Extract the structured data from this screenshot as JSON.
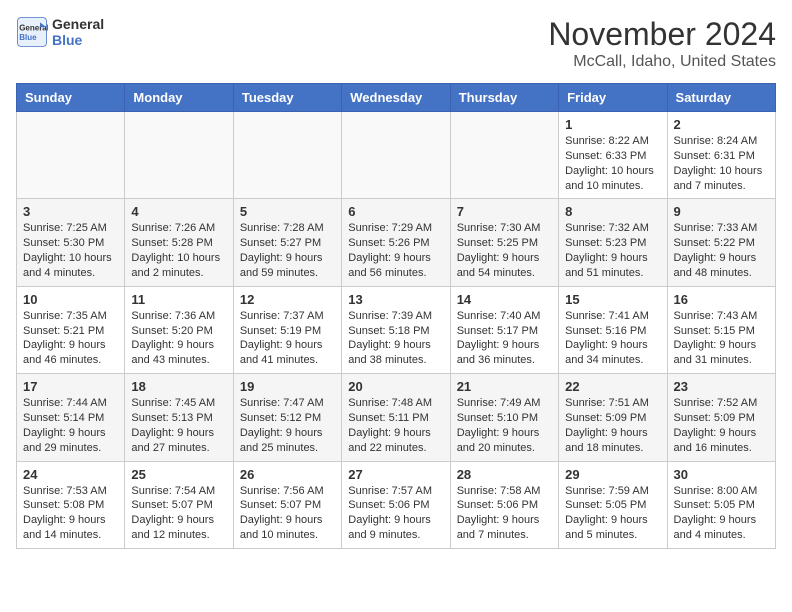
{
  "header": {
    "logo_line1": "General",
    "logo_line2": "Blue",
    "month": "November 2024",
    "location": "McCall, Idaho, United States"
  },
  "days_of_week": [
    "Sunday",
    "Monday",
    "Tuesday",
    "Wednesday",
    "Thursday",
    "Friday",
    "Saturday"
  ],
  "weeks": [
    [
      {
        "day": "",
        "data": ""
      },
      {
        "day": "",
        "data": ""
      },
      {
        "day": "",
        "data": ""
      },
      {
        "day": "",
        "data": ""
      },
      {
        "day": "",
        "data": ""
      },
      {
        "day": "1",
        "data": "Sunrise: 8:22 AM\nSunset: 6:33 PM\nDaylight: 10 hours and 10 minutes."
      },
      {
        "day": "2",
        "data": "Sunrise: 8:24 AM\nSunset: 6:31 PM\nDaylight: 10 hours and 7 minutes."
      }
    ],
    [
      {
        "day": "3",
        "data": "Sunrise: 7:25 AM\nSunset: 5:30 PM\nDaylight: 10 hours and 4 minutes."
      },
      {
        "day": "4",
        "data": "Sunrise: 7:26 AM\nSunset: 5:28 PM\nDaylight: 10 hours and 2 minutes."
      },
      {
        "day": "5",
        "data": "Sunrise: 7:28 AM\nSunset: 5:27 PM\nDaylight: 9 hours and 59 minutes."
      },
      {
        "day": "6",
        "data": "Sunrise: 7:29 AM\nSunset: 5:26 PM\nDaylight: 9 hours and 56 minutes."
      },
      {
        "day": "7",
        "data": "Sunrise: 7:30 AM\nSunset: 5:25 PM\nDaylight: 9 hours and 54 minutes."
      },
      {
        "day": "8",
        "data": "Sunrise: 7:32 AM\nSunset: 5:23 PM\nDaylight: 9 hours and 51 minutes."
      },
      {
        "day": "9",
        "data": "Sunrise: 7:33 AM\nSunset: 5:22 PM\nDaylight: 9 hours and 48 minutes."
      }
    ],
    [
      {
        "day": "10",
        "data": "Sunrise: 7:35 AM\nSunset: 5:21 PM\nDaylight: 9 hours and 46 minutes."
      },
      {
        "day": "11",
        "data": "Sunrise: 7:36 AM\nSunset: 5:20 PM\nDaylight: 9 hours and 43 minutes."
      },
      {
        "day": "12",
        "data": "Sunrise: 7:37 AM\nSunset: 5:19 PM\nDaylight: 9 hours and 41 minutes."
      },
      {
        "day": "13",
        "data": "Sunrise: 7:39 AM\nSunset: 5:18 PM\nDaylight: 9 hours and 38 minutes."
      },
      {
        "day": "14",
        "data": "Sunrise: 7:40 AM\nSunset: 5:17 PM\nDaylight: 9 hours and 36 minutes."
      },
      {
        "day": "15",
        "data": "Sunrise: 7:41 AM\nSunset: 5:16 PM\nDaylight: 9 hours and 34 minutes."
      },
      {
        "day": "16",
        "data": "Sunrise: 7:43 AM\nSunset: 5:15 PM\nDaylight: 9 hours and 31 minutes."
      }
    ],
    [
      {
        "day": "17",
        "data": "Sunrise: 7:44 AM\nSunset: 5:14 PM\nDaylight: 9 hours and 29 minutes."
      },
      {
        "day": "18",
        "data": "Sunrise: 7:45 AM\nSunset: 5:13 PM\nDaylight: 9 hours and 27 minutes."
      },
      {
        "day": "19",
        "data": "Sunrise: 7:47 AM\nSunset: 5:12 PM\nDaylight: 9 hours and 25 minutes."
      },
      {
        "day": "20",
        "data": "Sunrise: 7:48 AM\nSunset: 5:11 PM\nDaylight: 9 hours and 22 minutes."
      },
      {
        "day": "21",
        "data": "Sunrise: 7:49 AM\nSunset: 5:10 PM\nDaylight: 9 hours and 20 minutes."
      },
      {
        "day": "22",
        "data": "Sunrise: 7:51 AM\nSunset: 5:09 PM\nDaylight: 9 hours and 18 minutes."
      },
      {
        "day": "23",
        "data": "Sunrise: 7:52 AM\nSunset: 5:09 PM\nDaylight: 9 hours and 16 minutes."
      }
    ],
    [
      {
        "day": "24",
        "data": "Sunrise: 7:53 AM\nSunset: 5:08 PM\nDaylight: 9 hours and 14 minutes."
      },
      {
        "day": "25",
        "data": "Sunrise: 7:54 AM\nSunset: 5:07 PM\nDaylight: 9 hours and 12 minutes."
      },
      {
        "day": "26",
        "data": "Sunrise: 7:56 AM\nSunset: 5:07 PM\nDaylight: 9 hours and 10 minutes."
      },
      {
        "day": "27",
        "data": "Sunrise: 7:57 AM\nSunset: 5:06 PM\nDaylight: 9 hours and 9 minutes."
      },
      {
        "day": "28",
        "data": "Sunrise: 7:58 AM\nSunset: 5:06 PM\nDaylight: 9 hours and 7 minutes."
      },
      {
        "day": "29",
        "data": "Sunrise: 7:59 AM\nSunset: 5:05 PM\nDaylight: 9 hours and 5 minutes."
      },
      {
        "day": "30",
        "data": "Sunrise: 8:00 AM\nSunset: 5:05 PM\nDaylight: 9 hours and 4 minutes."
      }
    ]
  ]
}
